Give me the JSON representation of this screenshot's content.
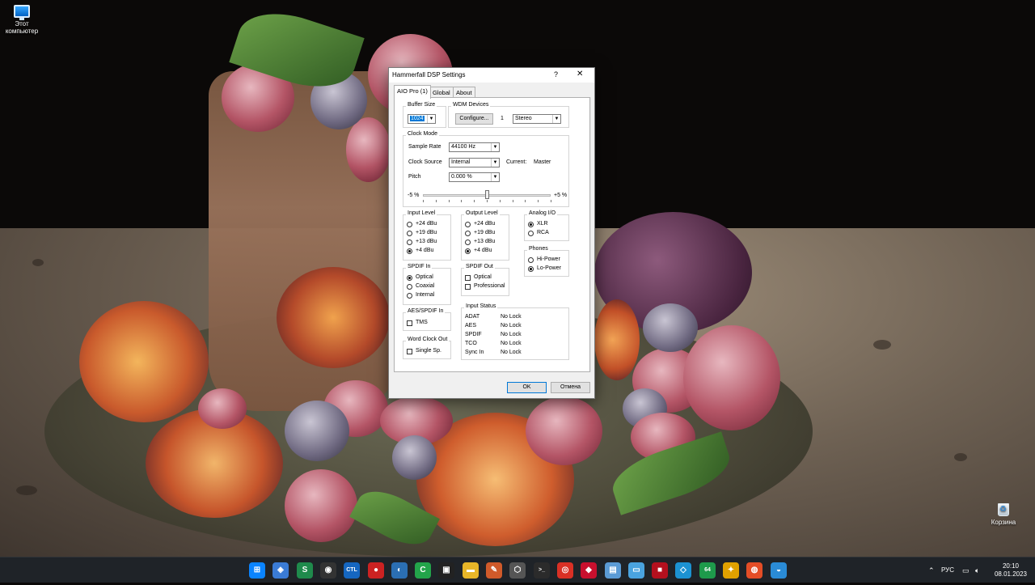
{
  "desktop": {
    "this_pc_label": "Этот компьютер",
    "recycle_bin_label": "Корзина"
  },
  "dialog": {
    "title": "Hammerfall DSP Settings",
    "help_glyph": "?",
    "close_glyph": "✕",
    "tabs": [
      "AIO Pro (1)",
      "Global",
      "About"
    ],
    "buffer_size": {
      "label": "Buffer Size",
      "value": "1024"
    },
    "wdm": {
      "label": "WDM Devices",
      "configure_label": "Configure...",
      "count": "1",
      "mode": "Stereo"
    },
    "clock_mode": {
      "label": "Clock Mode",
      "sample_rate_label": "Sample Rate",
      "sample_rate": "44100 Hz",
      "clock_source_label": "Clock Source",
      "clock_source": "Internal",
      "current_label": "Current:",
      "current_value": "Master",
      "pitch_label": "Pitch",
      "pitch": "0.000 %",
      "slider_min": "-5 %",
      "slider_max": "+5 %",
      "slider_position": 0.5
    },
    "input_level": {
      "label": "Input Level",
      "options": [
        "+24 dBu",
        "+19 dBu",
        "+13 dBu",
        "+4 dBu"
      ],
      "selected": 3
    },
    "output_level": {
      "label": "Output Level",
      "options": [
        "+24 dBu",
        "+19 dBu",
        "+13 dBu",
        "+4 dBu"
      ],
      "selected": 3
    },
    "analog_io": {
      "label": "Analog I/O",
      "options": [
        "XLR",
        "RCA"
      ],
      "selected": 0
    },
    "phones": {
      "label": "Phones",
      "options": [
        "Hi-Power",
        "Lo-Power"
      ],
      "selected": 1
    },
    "spdif_in": {
      "label": "SPDIF In",
      "options": [
        "Optical",
        "Coaxial",
        "Internal"
      ],
      "selected": 0
    },
    "spdif_out": {
      "label": "SPDIF Out",
      "options": [
        "Optical",
        "Professional"
      ]
    },
    "aes_spdif_in": {
      "label": "AES/SPDIF In",
      "option": "TMS"
    },
    "word_clock_out": {
      "label": "Word Clock Out",
      "option": "Single Sp."
    },
    "input_status": {
      "label": "Input Status",
      "rows": [
        {
          "name": "ADAT",
          "value": "No Lock"
        },
        {
          "name": "AES",
          "value": "No Lock"
        },
        {
          "name": "SPDIF",
          "value": "No Lock"
        },
        {
          "name": "TCO",
          "value": "No Lock"
        },
        {
          "name": "Sync In",
          "value": "No Lock"
        }
      ]
    },
    "ok_label": "OK",
    "cancel_label": "Отмена"
  },
  "taskbar": {
    "language": "РУС",
    "time": "20:10",
    "date": "08.01.2023",
    "apps": [
      {
        "name": "start",
        "glyph": "⊞",
        "color": "#0a84ff"
      },
      {
        "name": "app-a",
        "glyph": "◈",
        "color": "#3a7bd5"
      },
      {
        "name": "app-s",
        "glyph": "S",
        "color": "#1f8a4c"
      },
      {
        "name": "app-wavelab",
        "glyph": "◉",
        "color": "#333"
      },
      {
        "name": "app-ctl",
        "glyph": "CTL",
        "color": "#1566c0"
      },
      {
        "name": "app-red",
        "glyph": "●",
        "color": "#c22"
      },
      {
        "name": "app-compass",
        "glyph": "◐",
        "color": "#2b6fb3"
      },
      {
        "name": "app-c",
        "glyph": "C",
        "color": "#23a44a"
      },
      {
        "name": "app-dark",
        "glyph": "▣",
        "color": "#222"
      },
      {
        "name": "app-folder",
        "glyph": "▬",
        "color": "#e8b628"
      },
      {
        "name": "app-paint",
        "glyph": "✎",
        "color": "#d05a2a"
      },
      {
        "name": "app-cube",
        "glyph": "⬡",
        "color": "#555"
      },
      {
        "name": "app-terminal",
        "glyph": ">_",
        "color": "#2b2b2b"
      },
      {
        "name": "app-chrome",
        "glyph": "◎",
        "color": "#d93025"
      },
      {
        "name": "app-shield",
        "glyph": "◆",
        "color": "#c8102e"
      },
      {
        "name": "app-doc",
        "glyph": "▤",
        "color": "#5b9bd5"
      },
      {
        "name": "app-screen",
        "glyph": "▭",
        "color": "#4aa3df"
      },
      {
        "name": "app-pdf",
        "glyph": "■",
        "color": "#b3101e"
      },
      {
        "name": "app-blue",
        "glyph": "◇",
        "color": "#1c92d2"
      },
      {
        "name": "app-64",
        "glyph": "64",
        "color": "#1e9a4b"
      },
      {
        "name": "app-bird",
        "glyph": "✦",
        "color": "#e0a100"
      },
      {
        "name": "app-swirl",
        "glyph": "◍",
        "color": "#e44d26"
      },
      {
        "name": "app-globe",
        "glyph": "◒",
        "color": "#2a8bd6"
      }
    ]
  }
}
